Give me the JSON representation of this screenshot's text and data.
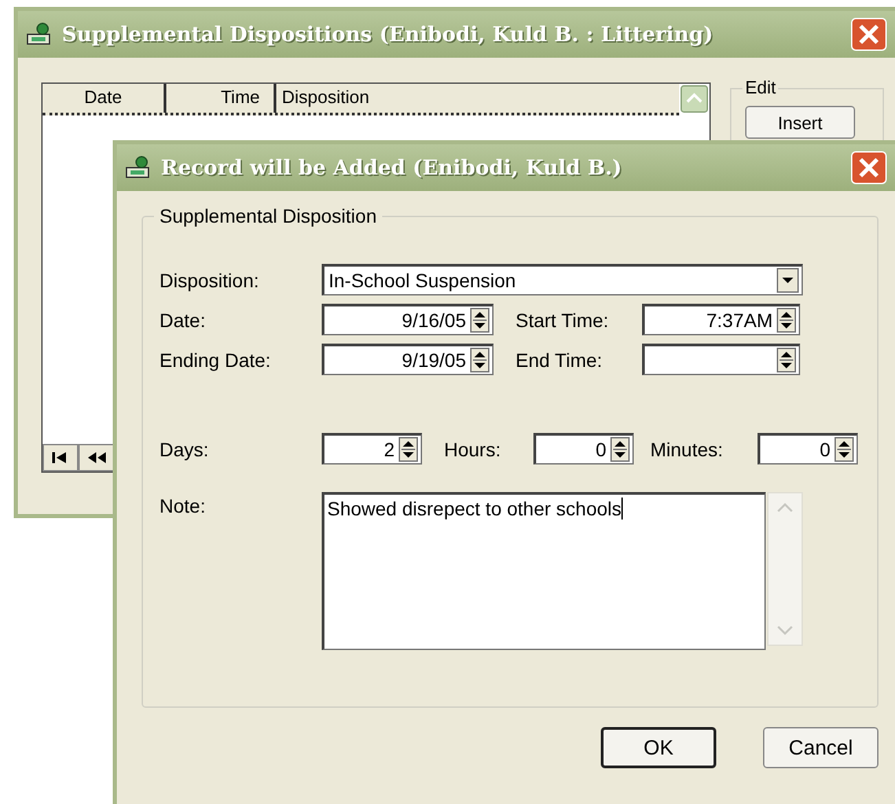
{
  "back_window": {
    "title": "Supplemental Dispositions (Enibodi, Kuld B. : Littering)",
    "grid": {
      "columns": [
        "Date",
        "Time",
        "Disposition"
      ]
    },
    "edit_group": {
      "label": "Edit",
      "buttons": [
        "Insert"
      ]
    }
  },
  "dialog": {
    "title": "Record will be Added  (Enibodi, Kuld B.)",
    "group": {
      "label": "Supplemental Disposition"
    },
    "fields": [
      {
        "kind": "combo",
        "label": "Disposition:",
        "value": "In-School Suspension"
      },
      {
        "kind": "spin",
        "label": "Date:",
        "value": "9/16/05"
      },
      {
        "kind": "spin",
        "label": "Start Time:",
        "value": "7:37AM"
      },
      {
        "kind": "spin",
        "label": "Ending Date:",
        "value": "9/19/05"
      },
      {
        "kind": "spin",
        "label": "End Time:"
      },
      {
        "kind": "spin",
        "label": "Days:",
        "value": "2"
      },
      {
        "kind": "spin",
        "label": "Hours:",
        "value": "0"
      },
      {
        "kind": "spin",
        "label": "Minutes:",
        "value": "0"
      }
    ],
    "note": {
      "label": "Note:",
      "value": "Showed disrepect to other schools"
    },
    "buttons": [
      {
        "label": "OK",
        "default": true
      },
      {
        "label": "Cancel",
        "default": false
      }
    ]
  }
}
